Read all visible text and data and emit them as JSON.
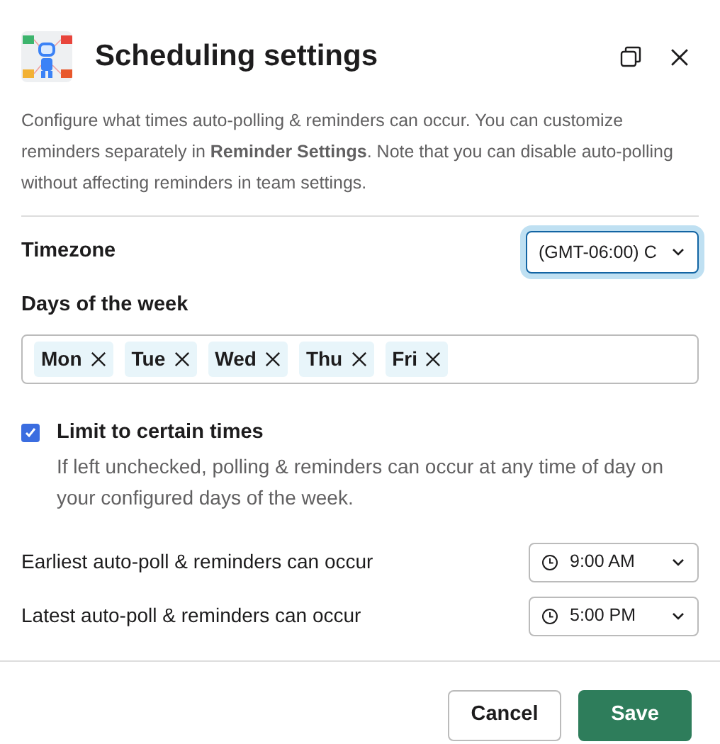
{
  "dialog": {
    "title": "Scheduling settings"
  },
  "description": "Configure what times auto-polling & reminders can occur. You can customize reminders separately in **Reminder Settings**. Note that you can disable auto-polling without affecting reminders in team settings.",
  "timezone": {
    "label": "Timezone",
    "value": "(GMT-06:00) C",
    "focused": true
  },
  "days": {
    "label": "Days of the week",
    "tags": [
      "Mon",
      "Tue",
      "Wed",
      "Thu",
      "Fri"
    ]
  },
  "limit": {
    "label": "Limit to certain times",
    "checked": true,
    "hint": "If left unchecked, polling & reminders can occur at any time of day on your configured days of the week."
  },
  "times": [
    {
      "label": "Earliest auto-poll & reminders can occur",
      "value": "9:00 AM"
    },
    {
      "label": "Latest auto-poll & reminders can occur",
      "value": "5:00 PM"
    }
  ],
  "buttons": {
    "cancel": "Cancel",
    "save": "Save"
  }
}
